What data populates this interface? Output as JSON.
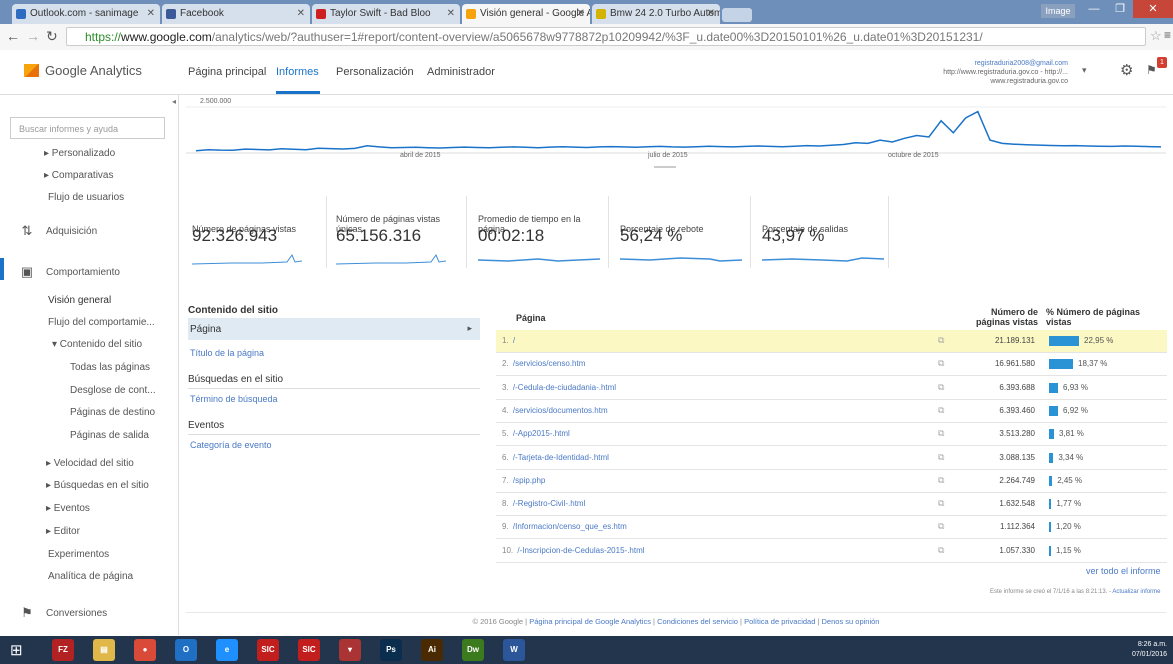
{
  "browser": {
    "tabs": [
      {
        "label": "Outlook.com - sanimage",
        "color": "#2d6cc0"
      },
      {
        "label": "Facebook",
        "color": "#3b5998"
      },
      {
        "label": "Taylor Swift - Bad Bloo",
        "color": "#cc1f1f"
      },
      {
        "label": "Visión general - Google A",
        "color": "#f7a30c"
      },
      {
        "label": "Bmw 24 2.0 Turbo Autom",
        "color": "#d4b200"
      }
    ],
    "image_btn": "Image",
    "url_scheme": "https://",
    "url_host": "www.google.com",
    "url_rest": "/analytics/web/?authuser=1#report/content-overview/a5065678w9778872p10209942/%3F_u.date00%3D20150101%26_u.date01%3D20151231/"
  },
  "ga": {
    "logo": "Google Analytics",
    "nav": [
      "Página principal",
      "Informes",
      "Personalización",
      "Administrador"
    ],
    "account_email": "registraduria2008@gmail.com",
    "account_line2": "http://www.registraduria.gov.co - http://...",
    "account_line3": "www.registraduria.gov.co",
    "notif_count": "1"
  },
  "sidebar": {
    "search_placeholder": "Buscar informes y ayuda",
    "items": {
      "personalizado": "▸ Personalizado",
      "comparativas": "▸ Comparativas",
      "flujo_usuarios": "Flujo de usuarios",
      "adquisicion": "Adquisición",
      "comportamiento": "Comportamiento",
      "vision_general": "Visión general",
      "flujo_comportamiento": "Flujo del comportamie...",
      "contenido_sitio": "▾ Contenido del sitio",
      "todas_paginas": "Todas las páginas",
      "desglose": "Desglose de cont...",
      "paginas_destino": "Páginas de destino",
      "paginas_salida": "Páginas de salida",
      "velocidad": "▸ Velocidad del sitio",
      "busquedas": "▸ Búsquedas en el sitio",
      "eventos": "▸ Eventos",
      "editor": "▸ Editor",
      "experimentos": "Experimentos",
      "analitica": "Analítica de página",
      "conversiones": "Conversiones"
    }
  },
  "chart_data": {
    "type": "line",
    "y_label_top": "2.500.000",
    "x_ticks": [
      "abril de 2015",
      "julio de 2015",
      "octubre de 2015"
    ],
    "series": [
      {
        "values": [
          120000,
          180000,
          160000,
          150000,
          210000,
          190000,
          170000,
          230000,
          200000,
          180000,
          260000,
          240000,
          220000,
          250000,
          390000,
          330000,
          280000,
          300000,
          310000,
          290000,
          270000,
          300000,
          320000,
          300000,
          280000,
          310000,
          330000,
          310000,
          290000,
          320000,
          340000,
          320000,
          300000,
          330000,
          350000,
          330000,
          310000,
          340000,
          360000,
          330000,
          320000,
          340000,
          370000,
          350000,
          330000,
          360000,
          380000,
          360000,
          340000,
          370000,
          400000,
          380000,
          420000,
          460000,
          560000,
          520000,
          700000,
          600000,
          800000,
          950000,
          870000,
          1750000,
          1100000,
          1900000,
          2250000,
          700000,
          520000,
          480000,
          450000,
          430000,
          410000,
          390000,
          400000,
          380000,
          370000,
          360000,
          380000,
          370000,
          350000,
          330000
        ]
      }
    ]
  },
  "metrics": [
    {
      "label": "Número de páginas vistas",
      "value": "92.326.943"
    },
    {
      "label": "Número de páginas vistas únicas",
      "value": "65.156.316"
    },
    {
      "label": "Promedio de tiempo en la página",
      "value": "00:02:18"
    },
    {
      "label": "Porcentaje de rebote",
      "value": "56,24 %"
    },
    {
      "label": "Porcentaje de salidas",
      "value": "43,97 %"
    }
  ],
  "content_menu": {
    "h1": "Contenido del sitio",
    "selected": "Página",
    "l1": "Título de la página",
    "h2": "Búsquedas en el sitio",
    "l2": "Término de búsqueda",
    "h3": "Eventos",
    "l3": "Categoría de evento"
  },
  "table": {
    "col_page": "Página",
    "col_views": "Número de páginas vistas",
    "col_pct": "% Número de páginas vistas",
    "rows": [
      {
        "n": "1.",
        "page": "/",
        "views": "21.189.131",
        "pct": "22,95 %",
        "share": 22.95
      },
      {
        "n": "2.",
        "page": "/servicios/censo.htm",
        "views": "16.961.580",
        "pct": "18,37 %",
        "share": 18.37
      },
      {
        "n": "3.",
        "page": "/-Cedula-de-ciudadania-.html",
        "views": "6.393.688",
        "pct": "6,93 %",
        "share": 6.93
      },
      {
        "n": "4.",
        "page": "/servicios/documentos.htm",
        "views": "6.393.460",
        "pct": "6,92 %",
        "share": 6.92
      },
      {
        "n": "5.",
        "page": "/-App2015-.html",
        "views": "3.513.280",
        "pct": "3,81 %",
        "share": 3.81
      },
      {
        "n": "6.",
        "page": "/-Tarjeta-de-Identidad-.html",
        "views": "3.088.135",
        "pct": "3,34 %",
        "share": 3.34
      },
      {
        "n": "7.",
        "page": "/spip.php",
        "views": "2.264.749",
        "pct": "2,45 %",
        "share": 2.45
      },
      {
        "n": "8.",
        "page": "/-Registro-Civil-.html",
        "views": "1.632.548",
        "pct": "1,77 %",
        "share": 1.77
      },
      {
        "n": "9.",
        "page": "/Informacion/censo_que_es.htm",
        "views": "1.112.364",
        "pct": "1,20 %",
        "share": 1.2
      },
      {
        "n": "10.",
        "page": "/-Inscripcion-de-Cedulas-2015-.html",
        "views": "1.057.330",
        "pct": "1,15 %",
        "share": 1.15
      }
    ],
    "full_report": "ver todo el informe",
    "generated": "Este informe se creó el 7/1/16 a las 8:21:13. -",
    "refresh": "Actualizar informe"
  },
  "footer": {
    "copyright": "© 2016 Google |",
    "links": [
      "Página principal de Google Analytics",
      "Condiciones del servicio",
      "Política de privacidad",
      "Denos su opinión"
    ]
  },
  "taskbar": {
    "time": "8:26 a.m.",
    "date": "07/01/2016",
    "apps": [
      {
        "name": "filezilla",
        "glyph": "FZ",
        "color": "#b22222"
      },
      {
        "name": "folder",
        "glyph": "▤",
        "color": "#e0b84a"
      },
      {
        "name": "chrome",
        "glyph": "●",
        "color": "#d94a38"
      },
      {
        "name": "outlook",
        "glyph": "O",
        "color": "#1f6fc5"
      },
      {
        "name": "ie",
        "glyph": "e",
        "color": "#1e90ff"
      },
      {
        "name": "sic1",
        "glyph": "SIC",
        "color": "#c31e1e"
      },
      {
        "name": "sic2",
        "glyph": "SIC",
        "color": "#c31e1e"
      },
      {
        "name": "app",
        "glyph": "▾",
        "color": "#a33"
      },
      {
        "name": "photoshop",
        "glyph": "Ps",
        "color": "#0b2e4e"
      },
      {
        "name": "illustrator",
        "glyph": "Ai",
        "color": "#4a2a00"
      },
      {
        "name": "dreamweaver",
        "glyph": "Dw",
        "color": "#3c7a1e"
      },
      {
        "name": "word",
        "glyph": "W",
        "color": "#2b579a"
      }
    ]
  }
}
